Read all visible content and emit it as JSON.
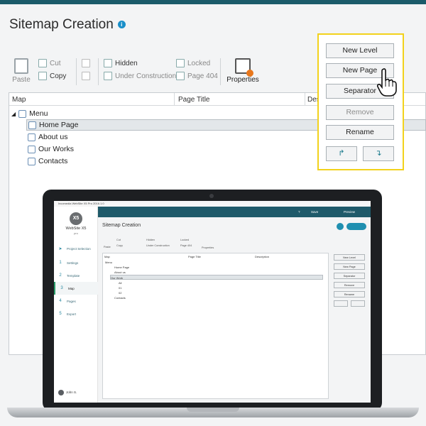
{
  "app": {
    "page_title": "Sitemap Creation",
    "info_icon": "info-icon"
  },
  "toolbar": {
    "paste": "Paste",
    "cut": "Cut",
    "copy": "Copy",
    "hidden": "Hidden",
    "under_construction": "Under Construction",
    "locked": "Locked",
    "page404": "Page 404",
    "properties": "Properties"
  },
  "tree": {
    "columns": [
      "Map",
      "Page Title",
      "Des"
    ],
    "items": [
      "Menu",
      "Home Page",
      "About us",
      "Our Works",
      "Contacts"
    ]
  },
  "panel": {
    "new_level": "New Level",
    "new_page": "New Page",
    "separator": "Separator",
    "remove": "Remove",
    "rename": "Rename",
    "up": "↱",
    "down": "↴"
  },
  "laptop": {
    "window_title": "Incomedia WebSite X5 Pro 2016.1.0",
    "brand": "WebSite X5",
    "edition": "pro",
    "logo": "X5",
    "header_save": "Save",
    "header_preview": "Preview",
    "title": "Sitemap Creation",
    "nav": [
      {
        "num": "",
        "label": "Project Selection"
      },
      {
        "num": "1",
        "label": "Settings"
      },
      {
        "num": "2",
        "label": "Template"
      },
      {
        "num": "3",
        "label": "Map"
      },
      {
        "num": "4",
        "label": "Pages"
      },
      {
        "num": "5",
        "label": "Export"
      }
    ],
    "user_name": "John S.",
    "toolbar": [
      "Paste",
      "Cut",
      "Copy",
      "Hidden",
      "Under Construction",
      "Locked",
      "Page 404",
      "Properties"
    ],
    "columns": [
      "Map",
      "Page Title",
      "Description"
    ],
    "tree": [
      "Menu",
      "Home Page",
      "About us",
      "Our Work",
      "All",
      "01",
      "02",
      "Contacts"
    ],
    "buttons": [
      "New Level",
      "New Page",
      "Separator",
      "Remove",
      "Rename"
    ]
  },
  "colors": {
    "accent": "#1f5a6a",
    "highlight": "#f2d21c"
  }
}
